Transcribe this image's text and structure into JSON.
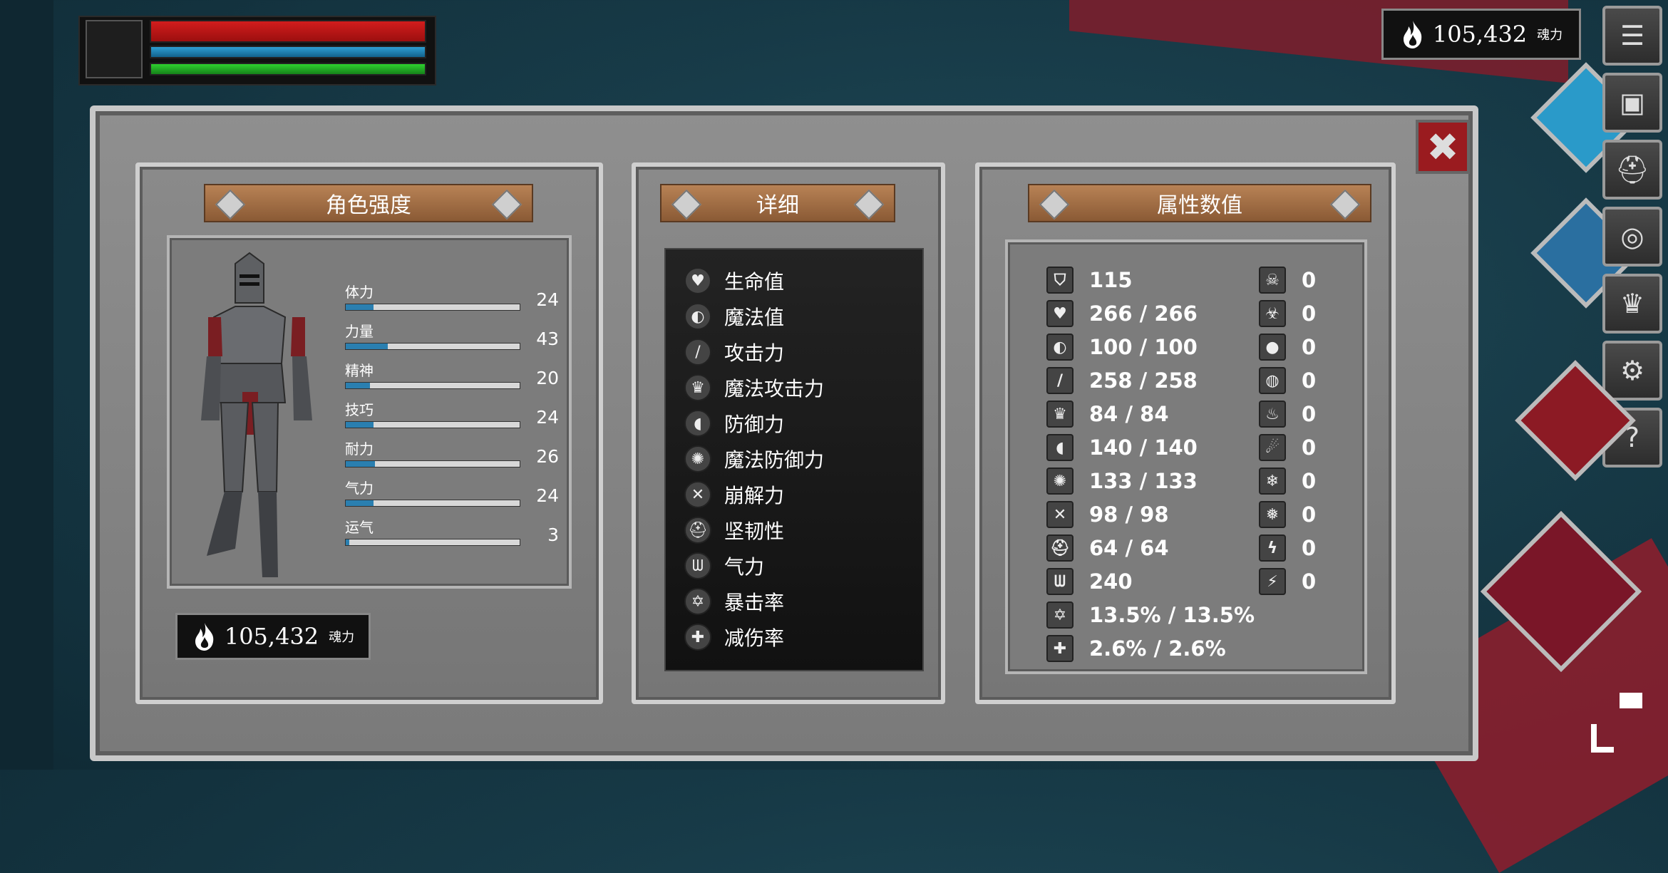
{
  "currency": {
    "value": "105,432",
    "unit": "魂力"
  },
  "panels": {
    "strength_title": "角色强度",
    "detail_title": "详细",
    "attributes_title": "属性数值"
  },
  "stats": [
    {
      "label": "体力",
      "value": "24",
      "fill": 0.16
    },
    {
      "label": "力量",
      "value": "43",
      "fill": 0.24
    },
    {
      "label": "精神",
      "value": "20",
      "fill": 0.14
    },
    {
      "label": "技巧",
      "value": "24",
      "fill": 0.16
    },
    {
      "label": "耐力",
      "value": "26",
      "fill": 0.17
    },
    {
      "label": "气力",
      "value": "24",
      "fill": 0.16
    },
    {
      "label": "运气",
      "value": "3",
      "fill": 0.02
    }
  ],
  "details": [
    {
      "label": "生命值",
      "icon": "heart-icon"
    },
    {
      "label": "魔法值",
      "icon": "head-icon"
    },
    {
      "label": "攻击力",
      "icon": "sword-icon"
    },
    {
      "label": "魔法攻击力",
      "icon": "crown-magic-icon"
    },
    {
      "label": "防御力",
      "icon": "shield-icon"
    },
    {
      "label": "魔法防御力",
      "icon": "magic-shield-icon"
    },
    {
      "label": "崩解力",
      "icon": "break-icon"
    },
    {
      "label": "坚韧性",
      "icon": "helmet-icon"
    },
    {
      "label": "气力",
      "icon": "lungs-icon"
    },
    {
      "label": "暴击率",
      "icon": "crit-star-icon"
    },
    {
      "label": "减伤率",
      "icon": "reduce-damage-icon"
    }
  ],
  "attributes_left": [
    {
      "value": "115",
      "icon": "armor-helmet-icon"
    },
    {
      "value": "266 / 266",
      "icon": "heart-icon"
    },
    {
      "value": "100 / 100",
      "icon": "head-icon"
    },
    {
      "value": "258 / 258",
      "icon": "sword-icon"
    },
    {
      "value": "84 / 84",
      "icon": "crown-magic-icon"
    },
    {
      "value": "140 / 140",
      "icon": "shield-icon"
    },
    {
      "value": "133 / 133",
      "icon": "magic-shield-icon"
    },
    {
      "value": "98 / 98",
      "icon": "break-icon"
    },
    {
      "value": "64 / 64",
      "icon": "helmet-icon"
    },
    {
      "value": "240",
      "icon": "lungs-icon"
    },
    {
      "value": "13.5% / 13.5%",
      "icon": "crit-star-icon"
    },
    {
      "value": "2.6% / 2.6%",
      "icon": "reduce-damage-icon"
    }
  ],
  "attributes_right": [
    {
      "value": "0",
      "icon": "poison-skull-icon"
    },
    {
      "value": "0",
      "icon": "curse-icon"
    },
    {
      "value": "0",
      "icon": "bleed-drop-icon"
    },
    {
      "value": "0",
      "icon": "bleed-resist-icon"
    },
    {
      "value": "0",
      "icon": "fire-icon"
    },
    {
      "value": "0",
      "icon": "fire-resist-icon"
    },
    {
      "value": "0",
      "icon": "frost-icon"
    },
    {
      "value": "0",
      "icon": "frost-resist-icon"
    },
    {
      "value": "0",
      "icon": "lightning-icon"
    },
    {
      "value": "0",
      "icon": "lightning-resist-icon"
    }
  ],
  "colors": {
    "hp": "#c41a1a",
    "mp": "#1f83b8",
    "stamina": "#22b022",
    "close": "#9a1b1f",
    "banner": "#a06b40"
  }
}
